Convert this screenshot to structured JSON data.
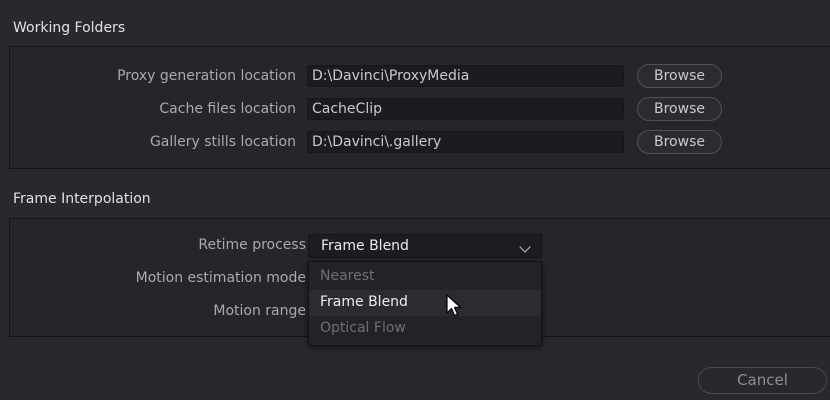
{
  "working_folders": {
    "title": "Working Folders",
    "rows": [
      {
        "label": "Proxy generation location",
        "value": "D:\\Davinci\\ProxyMedia",
        "button": "Browse"
      },
      {
        "label": "Cache files location",
        "value": "CacheClip",
        "button": "Browse"
      },
      {
        "label": "Gallery stills location",
        "value": "D:\\Davinci\\.gallery",
        "button": "Browse"
      }
    ]
  },
  "frame_interpolation": {
    "title": "Frame Interpolation",
    "retime_label": "Retime process",
    "retime_value": "Frame Blend",
    "motion_mode_label": "Motion estimation mode",
    "motion_range_label": "Motion range",
    "options": [
      {
        "label": "Nearest",
        "state": "disabled"
      },
      {
        "label": "Frame Blend",
        "state": "selected"
      },
      {
        "label": "Optical Flow",
        "state": "disabled"
      }
    ]
  },
  "footer": {
    "cancel_label": "Cancel"
  },
  "icons": {
    "dropdown": "chevron-down-icon",
    "pointer": "mouse-cursor-icon"
  },
  "colors": {
    "background": "#28282e",
    "field": "#1c1c20",
    "text": "#d4d4d8"
  }
}
